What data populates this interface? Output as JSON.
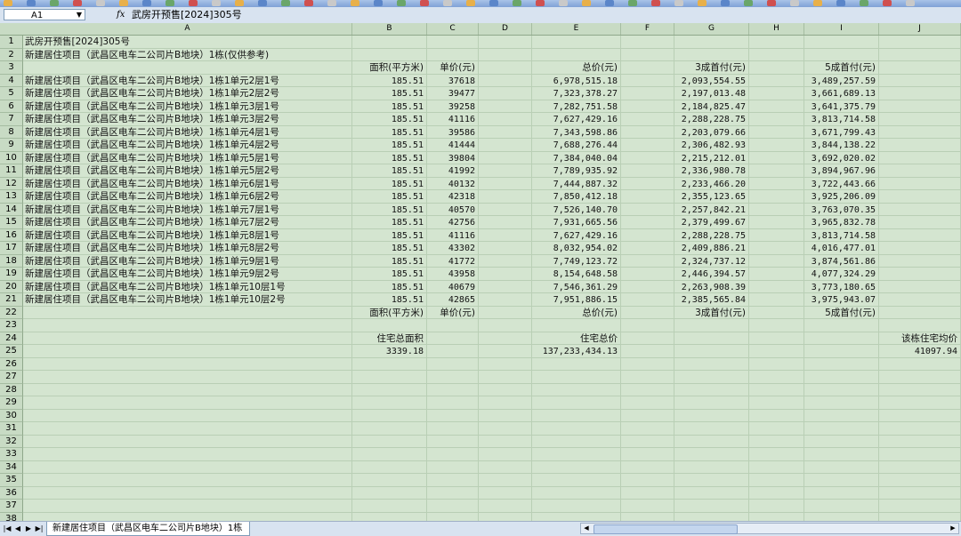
{
  "namebox": "A1",
  "formula": "武房开预售[2024]305号",
  "columns": [
    "A",
    "B",
    "C",
    "D",
    "E",
    "F",
    "G",
    "H",
    "I",
    "J"
  ],
  "rows_visible": 38,
  "row1": "武房开预售[2024]305号",
  "row2": "新建居住项目（武昌区电车二公司片B地块）1栋(仅供参考)",
  "headers": {
    "area": "面积(平方米)",
    "unit_price": "单价(元)",
    "total": "总价(元)",
    "down30": "3成首付(元)",
    "down50": "5成首付(元)"
  },
  "units": [
    {
      "name": "新建居住项目（武昌区电车二公司片B地块）1栋1单元2层1号",
      "area": "185.51",
      "price": "37618",
      "total": "6,978,515.18",
      "d30": "2,093,554.55",
      "d50": "3,489,257.59"
    },
    {
      "name": "新建居住项目（武昌区电车二公司片B地块）1栋1单元2层2号",
      "area": "185.51",
      "price": "39477",
      "total": "7,323,378.27",
      "d30": "2,197,013.48",
      "d50": "3,661,689.13"
    },
    {
      "name": "新建居住项目（武昌区电车二公司片B地块）1栋1单元3层1号",
      "area": "185.51",
      "price": "39258",
      "total": "7,282,751.58",
      "d30": "2,184,825.47",
      "d50": "3,641,375.79"
    },
    {
      "name": "新建居住项目（武昌区电车二公司片B地块）1栋1单元3层2号",
      "area": "185.51",
      "price": "41116",
      "total": "7,627,429.16",
      "d30": "2,288,228.75",
      "d50": "3,813,714.58"
    },
    {
      "name": "新建居住项目（武昌区电车二公司片B地块）1栋1单元4层1号",
      "area": "185.51",
      "price": "39586",
      "total": "7,343,598.86",
      "d30": "2,203,079.66",
      "d50": "3,671,799.43"
    },
    {
      "name": "新建居住项目（武昌区电车二公司片B地块）1栋1单元4层2号",
      "area": "185.51",
      "price": "41444",
      "total": "7,688,276.44",
      "d30": "2,306,482.93",
      "d50": "3,844,138.22"
    },
    {
      "name": "新建居住项目（武昌区电车二公司片B地块）1栋1单元5层1号",
      "area": "185.51",
      "price": "39804",
      "total": "7,384,040.04",
      "d30": "2,215,212.01",
      "d50": "3,692,020.02"
    },
    {
      "name": "新建居住项目（武昌区电车二公司片B地块）1栋1单元5层2号",
      "area": "185.51",
      "price": "41992",
      "total": "7,789,935.92",
      "d30": "2,336,980.78",
      "d50": "3,894,967.96"
    },
    {
      "name": "新建居住项目（武昌区电车二公司片B地块）1栋1单元6层1号",
      "area": "185.51",
      "price": "40132",
      "total": "7,444,887.32",
      "d30": "2,233,466.20",
      "d50": "3,722,443.66"
    },
    {
      "name": "新建居住项目（武昌区电车二公司片B地块）1栋1单元6层2号",
      "area": "185.51",
      "price": "42318",
      "total": "7,850,412.18",
      "d30": "2,355,123.65",
      "d50": "3,925,206.09"
    },
    {
      "name": "新建居住项目（武昌区电车二公司片B地块）1栋1单元7层1号",
      "area": "185.51",
      "price": "40570",
      "total": "7,526,140.70",
      "d30": "2,257,842.21",
      "d50": "3,763,070.35"
    },
    {
      "name": "新建居住项目（武昌区电车二公司片B地块）1栋1单元7层2号",
      "area": "185.51",
      "price": "42756",
      "total": "7,931,665.56",
      "d30": "2,379,499.67",
      "d50": "3,965,832.78"
    },
    {
      "name": "新建居住项目（武昌区电车二公司片B地块）1栋1单元8层1号",
      "area": "185.51",
      "price": "41116",
      "total": "7,627,429.16",
      "d30": "2,288,228.75",
      "d50": "3,813,714.58"
    },
    {
      "name": "新建居住项目（武昌区电车二公司片B地块）1栋1单元8层2号",
      "area": "185.51",
      "price": "43302",
      "total": "8,032,954.02",
      "d30": "2,409,886.21",
      "d50": "4,016,477.01"
    },
    {
      "name": "新建居住项目（武昌区电车二公司片B地块）1栋1单元9层1号",
      "area": "185.51",
      "price": "41772",
      "total": "7,749,123.72",
      "d30": "2,324,737.12",
      "d50": "3,874,561.86"
    },
    {
      "name": "新建居住项目（武昌区电车二公司片B地块）1栋1单元9层2号",
      "area": "185.51",
      "price": "43958",
      "total": "8,154,648.58",
      "d30": "2,446,394.57",
      "d50": "4,077,324.29"
    },
    {
      "name": "新建居住项目（武昌区电车二公司片B地块）1栋1单元10层1号",
      "area": "185.51",
      "price": "40679",
      "total": "7,546,361.29",
      "d30": "2,263,908.39",
      "d50": "3,773,180.65"
    },
    {
      "name": "新建居住项目（武昌区电车二公司片B地块）1栋1单元10层2号",
      "area": "185.51",
      "price": "42865",
      "total": "7,951,886.15",
      "d30": "2,385,565.84",
      "d50": "3,975,943.07"
    }
  ],
  "summary": {
    "area_label": "住宅总面积",
    "area_value": "3339.18",
    "total_label": "住宅总价",
    "total_value": "137,233,434.13",
    "avg_label": "该栋住宅均价",
    "avg_value": "41097.94"
  },
  "sheet_tab": "新建居住项目（武昌区电车二公司片B地块）1栋"
}
